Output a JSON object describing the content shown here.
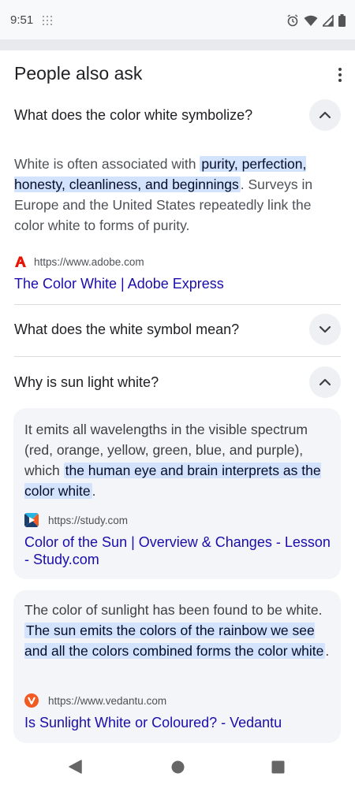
{
  "status": {
    "time": "9:51",
    "icons": [
      "grid-dots-icon",
      "alarm-icon",
      "wifi-icon",
      "signal-icon",
      "battery-icon"
    ]
  },
  "paa": {
    "title": "People also ask",
    "q1": {
      "question": "What does the color white symbolize?",
      "answer_pre": "White is often associated with ",
      "answer_hl": "purity, perfection, honesty, cleanliness, and beginnings",
      "answer_post": ". Surveys in Europe and the United States repeatedly link the color white to forms of purity.",
      "source_url": "https://www.adobe.com",
      "link": "The Color White | Adobe Express"
    },
    "q2": {
      "question": "What does the white symbol mean?"
    },
    "q3": {
      "question": "Why is sun light white?",
      "card1": {
        "answer_pre": "It emits all wavelengths in the visible spectrum (red, orange, yellow, green, blue, and purple), which ",
        "answer_hl": "the human eye and brain interprets as the color white",
        "answer_post": ".",
        "source_url": "https://study.com",
        "link": "Color of the Sun | Overview & Changes - Lesson - Study.com"
      },
      "card2": {
        "answer_pre": "The color of sunlight has been found to be white. ",
        "answer_hl": "The sun emits the colors of the rainbow we see and all the colors combined forms the color white",
        "answer_post": ".",
        "source_url": "https://www.vedantu.com",
        "link": "Is Sunlight White or Coloured? - Vedantu"
      }
    }
  },
  "nav": {
    "buttons": [
      "back-icon",
      "home-icon",
      "recents-icon"
    ]
  },
  "colors": {
    "link": "#1a0dab",
    "highlight": "#d3e3fd",
    "adobe": "#eb1000",
    "vedantu": "#f15a22"
  }
}
